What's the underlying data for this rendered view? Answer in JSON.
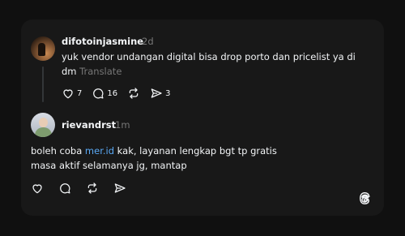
{
  "reply1": {
    "username": "difotoinjasmine",
    "time": "2d",
    "line1": "yuk vendor undangan digital bisa drop porto dan pricelist ya di",
    "line2": "dm",
    "translate": "Translate",
    "likes": "7",
    "comments": "16",
    "shares": "3"
  },
  "reply2": {
    "username": "rievandrst",
    "time": "1m",
    "line1_pre": "boleh coba ",
    "line1_link": "mer.id",
    "line1_post": " kak, layanan lengkap bgt tp gratis",
    "line2": "masa aktif selamanya jg, mantap"
  },
  "icons": {
    "like": "heart-icon",
    "comment": "comment-icon",
    "repost": "repost-icon",
    "share": "share-icon",
    "brand": "threads-logo-icon"
  },
  "colors": {
    "background": "#101010",
    "card": "#181818",
    "text": "#f3f5f7",
    "muted": "#777777",
    "link": "#5aa9f5"
  }
}
